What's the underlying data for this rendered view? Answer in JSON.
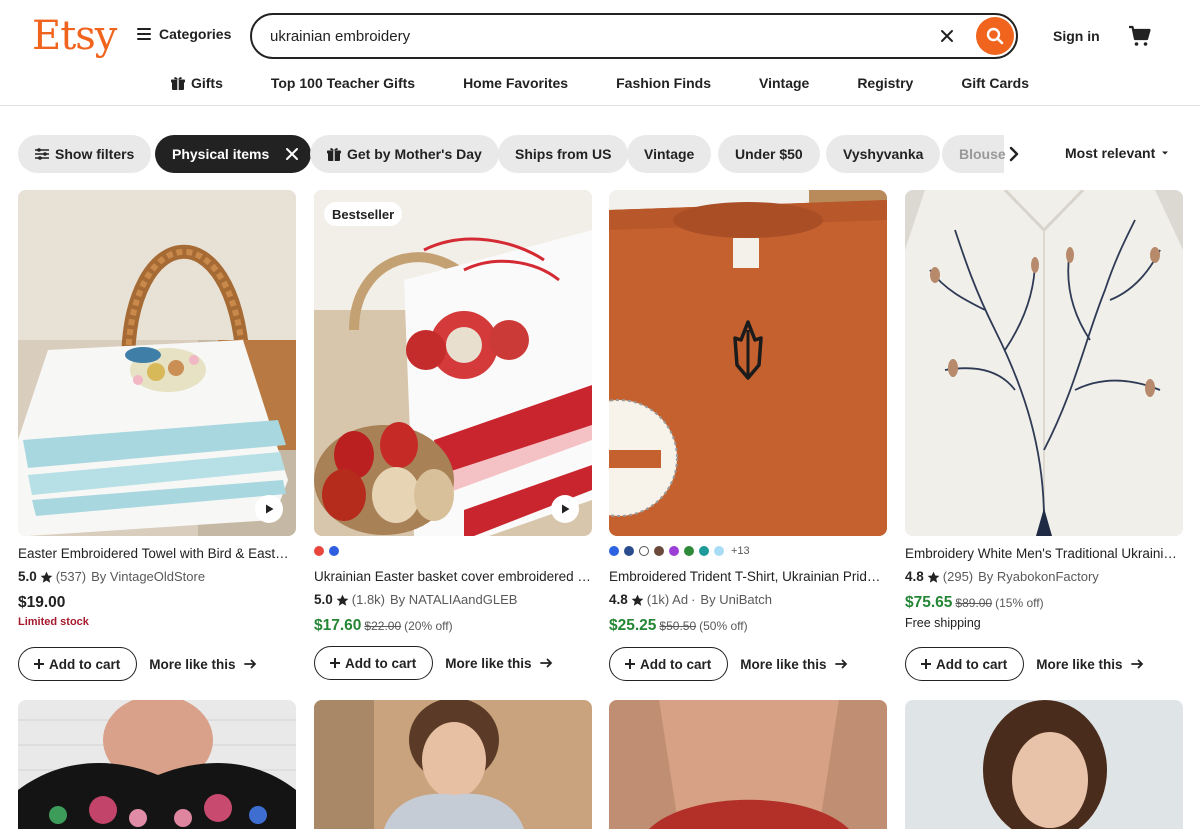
{
  "header": {
    "logo": "Etsy",
    "categories_label": "Categories",
    "search_value": "ukrainian embroidery",
    "sign_in": "Sign in",
    "accent": "#f1641e"
  },
  "subnav": [
    {
      "label": "Gifts",
      "icon": "gift-icon"
    },
    {
      "label": "Top 100 Teacher Gifts"
    },
    {
      "label": "Home Favorites"
    },
    {
      "label": "Fashion Finds"
    },
    {
      "label": "Vintage"
    },
    {
      "label": "Registry"
    },
    {
      "label": "Gift Cards"
    }
  ],
  "filters": {
    "show_filters": "Show filters",
    "physical_items": "Physical items",
    "mothers_day": "Get by Mother's Day",
    "ships_from": "Ships from US",
    "vintage": "Vintage",
    "under_50": "Under $50",
    "vyshyvanka": "Vyshyvanka",
    "blouse": "Blouse",
    "sort": "Most relevant"
  },
  "listings": [
    {
      "title": "Easter Embroidered Towel with Bird & Easter Eggs",
      "score": "5.0",
      "reviews": "(537)",
      "shop": "By VintageOldStore",
      "price": "$19.00",
      "note": "Limited stock",
      "has_video": true
    },
    {
      "badge": "Bestseller",
      "swatches": [
        "#e8463d",
        "#2f5fe0"
      ],
      "title": "Ukrainian Easter basket cover embroidered towel",
      "score": "5.0",
      "reviews": "(1.8k)",
      "shop": "By NATALIAandGLEB",
      "price": "$17.60",
      "original": "$22.00",
      "discount": "(20% off)",
      "has_video": true
    },
    {
      "swatches": [
        "#2d63e0",
        "#2a4c8e",
        "#ffffff",
        "#6b4a3b",
        "#9b3fd6",
        "#2d8a3a",
        "#1e9a9a",
        "#a8dcf5"
      ],
      "swatch_more": "+13",
      "title": "Embroidered Trident T-Shirt, Ukrainian Pride Shirt",
      "score": "4.8",
      "reviews": "(1k)",
      "ad": "Ad",
      "shop": "By UniBatch",
      "price": "$25.25",
      "original": "$50.50",
      "discount": "(50% off)"
    },
    {
      "title": "Embroidery White Men's Traditional Ukrainian Shirt",
      "score": "4.8",
      "reviews": "(295)",
      "shop": "By RyabokonFactory",
      "price": "$75.65",
      "original": "$89.00",
      "discount": "(15% off)",
      "note": "Free shipping"
    }
  ],
  "card_actions": {
    "add_to_cart": "Add to cart",
    "more_like_this": "More like this"
  },
  "second_row": 4
}
